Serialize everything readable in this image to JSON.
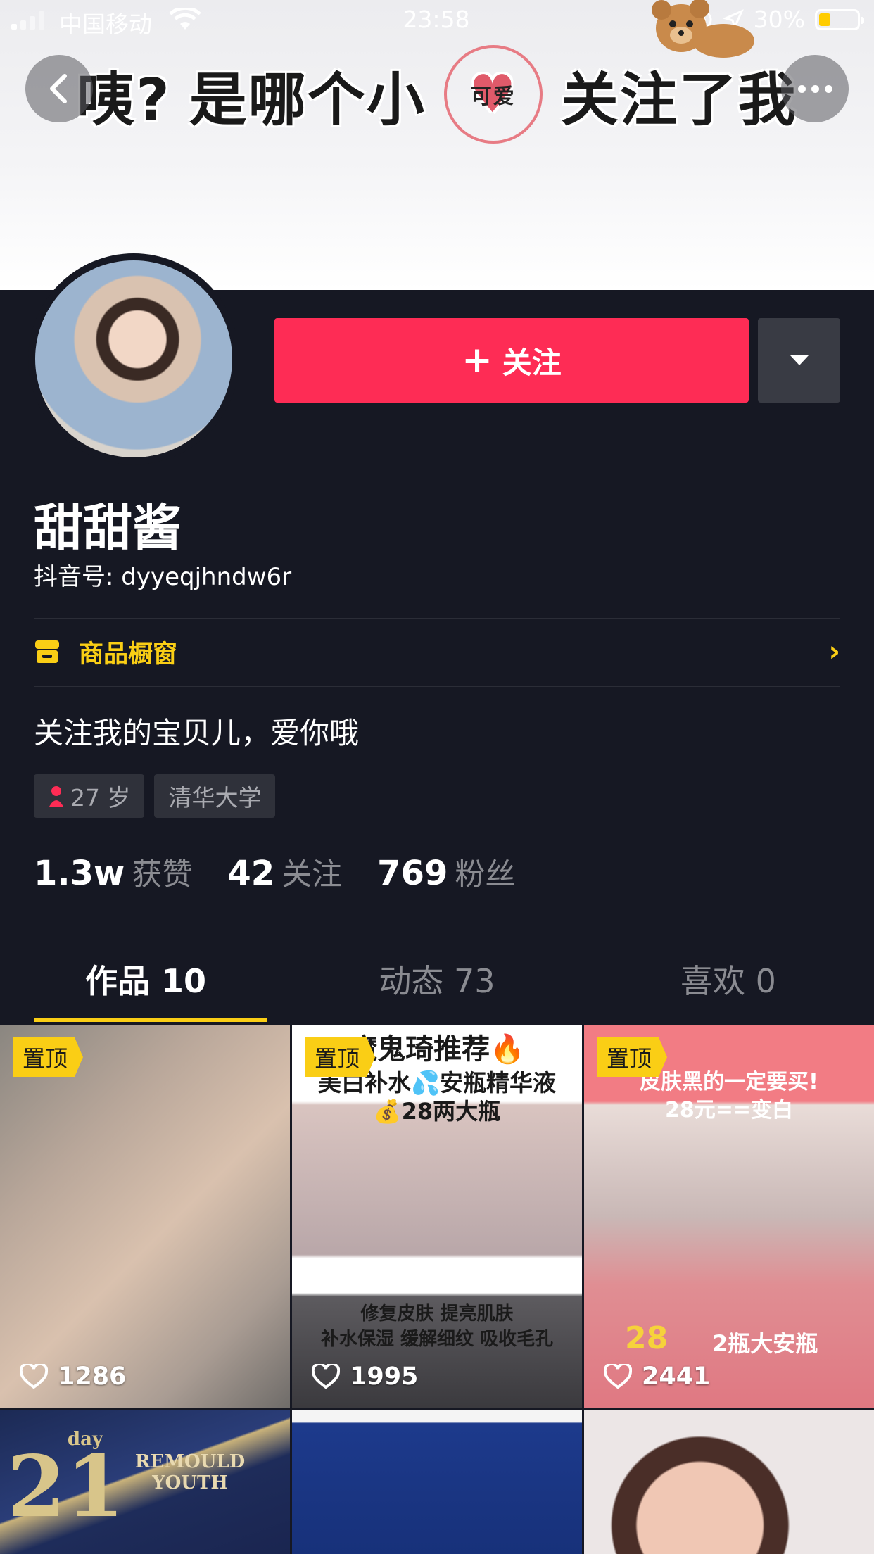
{
  "status_bar": {
    "carrier": "中国移动",
    "time": "23:58",
    "battery": "30%",
    "battery_level": 0.3
  },
  "banner": {
    "text_left": "咦?",
    "text_mid": "是哪个小",
    "bubble_label": "可爱",
    "text_right": "关注了我"
  },
  "profile": {
    "follow_label": "关注",
    "nickname": "甜甜酱",
    "douyin_id": "抖音号: dyyeqjhndw6r",
    "shop_label": "商品橱窗",
    "bio": "关注我的宝贝儿，爱你哦",
    "tags": [
      "27 岁",
      "清华大学"
    ],
    "stats": [
      {
        "value": "1.3w",
        "label": "获赞"
      },
      {
        "value": "42",
        "label": "关注"
      },
      {
        "value": "769",
        "label": "粉丝"
      }
    ]
  },
  "tabs": [
    {
      "label": "作品 10",
      "active": true
    },
    {
      "label": "动态 73",
      "active": false
    },
    {
      "label": "喜欢 0",
      "active": false
    }
  ],
  "videos": [
    {
      "pinned_label": "置顶",
      "likes": "1286"
    },
    {
      "pinned_label": "置顶",
      "likes": "1995",
      "caption_top1": "魔鬼琦推荐🔥",
      "caption_top2": "美白补水💦安瓶精华液",
      "caption_top3": "💰28两大瓶",
      "caption_bottom1": "修复皮肤 提亮肌肤",
      "caption_bottom2": "补水保湿 缓解细纹 吸收毛孔"
    },
    {
      "pinned_label": "置顶",
      "likes": "2441",
      "caption_top1": "皮肤黑的一定要买!",
      "caption_top2": "28元==变白",
      "caption_bottom1": "28",
      "caption_bottom2": "2瓶大安瓶"
    },
    {
      "caption": "REMOULD YOUTH",
      "caption2": "21",
      "caption3": "day"
    },
    {},
    {}
  ],
  "colors": {
    "accent_red": "#fe2c55",
    "accent_yellow": "#face15",
    "background": "#161823"
  }
}
